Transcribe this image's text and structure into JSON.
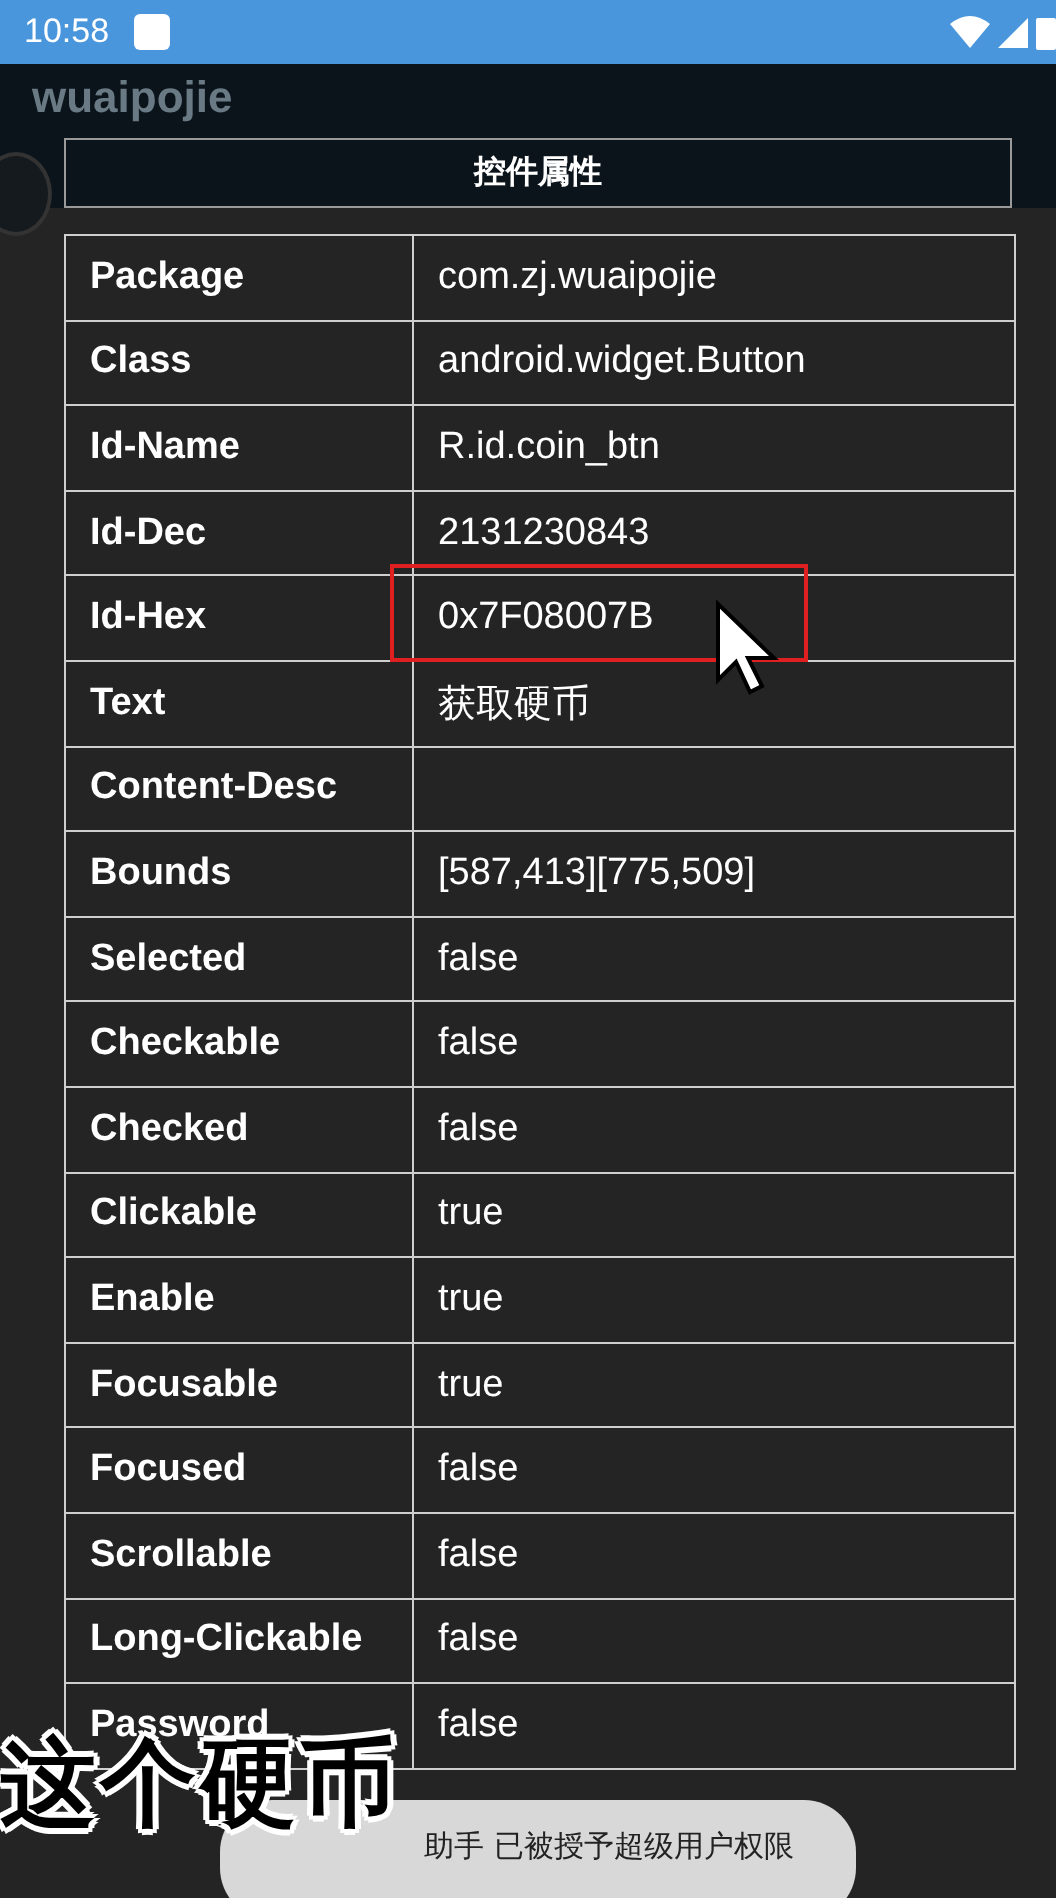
{
  "status_bar": {
    "time": "10:58"
  },
  "background": {
    "app_title": "wuaipojie"
  },
  "dialog": {
    "title": "控件属性",
    "rows": [
      {
        "label": "Package",
        "value": "com.zj.wuaipojie",
        "highlighted": false
      },
      {
        "label": "Class",
        "value": "android.widget.Button",
        "highlighted": false
      },
      {
        "label": "Id-Name",
        "value": "R.id.coin_btn",
        "highlighted": false
      },
      {
        "label": "Id-Dec",
        "value": "2131230843",
        "highlighted": false
      },
      {
        "label": "Id-Hex",
        "value": "0x7F08007B",
        "highlighted": true
      },
      {
        "label": "Text",
        "value": "获取硬币",
        "highlighted": false
      },
      {
        "label": "Content-Desc",
        "value": "",
        "highlighted": false
      },
      {
        "label": "Bounds",
        "value": "[587,413][775,509]",
        "highlighted": false
      },
      {
        "label": "Selected",
        "value": "false",
        "highlighted": false
      },
      {
        "label": "Checkable",
        "value": "false",
        "highlighted": false
      },
      {
        "label": "Checked",
        "value": "false",
        "highlighted": false
      },
      {
        "label": "Clickable",
        "value": "true",
        "highlighted": false
      },
      {
        "label": "Enable",
        "value": "true",
        "highlighted": false
      },
      {
        "label": "Focusable",
        "value": "true",
        "highlighted": false
      },
      {
        "label": "Focused",
        "value": "false",
        "highlighted": false
      },
      {
        "label": "Scrollable",
        "value": "false",
        "highlighted": false
      },
      {
        "label": "Long-Clickable",
        "value": "false",
        "highlighted": false
      },
      {
        "label": "Password",
        "value": "false",
        "highlighted": false
      }
    ]
  },
  "toast": {
    "text": "助手 已被授予超级用户权限"
  },
  "caption": {
    "text": "这个硬币"
  }
}
